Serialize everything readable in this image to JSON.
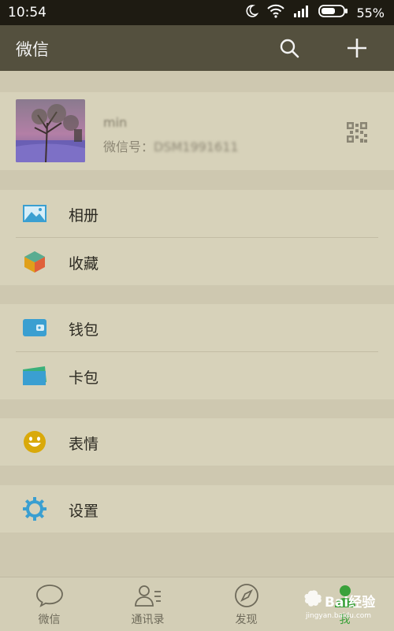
{
  "statusbar": {
    "time": "10:54",
    "battery": "55%"
  },
  "header": {
    "title": "微信"
  },
  "profile": {
    "name": "min",
    "id_label": "微信号：",
    "id_value": "DSM1991611"
  },
  "menu": {
    "album": "相册",
    "favorites": "收藏",
    "wallet": "钱包",
    "cards": "卡包",
    "stickers": "表情",
    "settings": "设置"
  },
  "tabs": [
    {
      "label": "微信",
      "icon": "chat-bubble-icon"
    },
    {
      "label": "通讯录",
      "icon": "contacts-icon"
    },
    {
      "label": "发现",
      "icon": "compass-icon"
    },
    {
      "label": "我",
      "icon": "me-icon"
    }
  ],
  "watermark": {
    "text": "Bai经验",
    "url": "jingyan.baidu.com"
  },
  "colors": {
    "accent_green": "#3aa13a",
    "icon_blue": "#3a9fd1",
    "smiley_yellow": "#d9a90a"
  }
}
